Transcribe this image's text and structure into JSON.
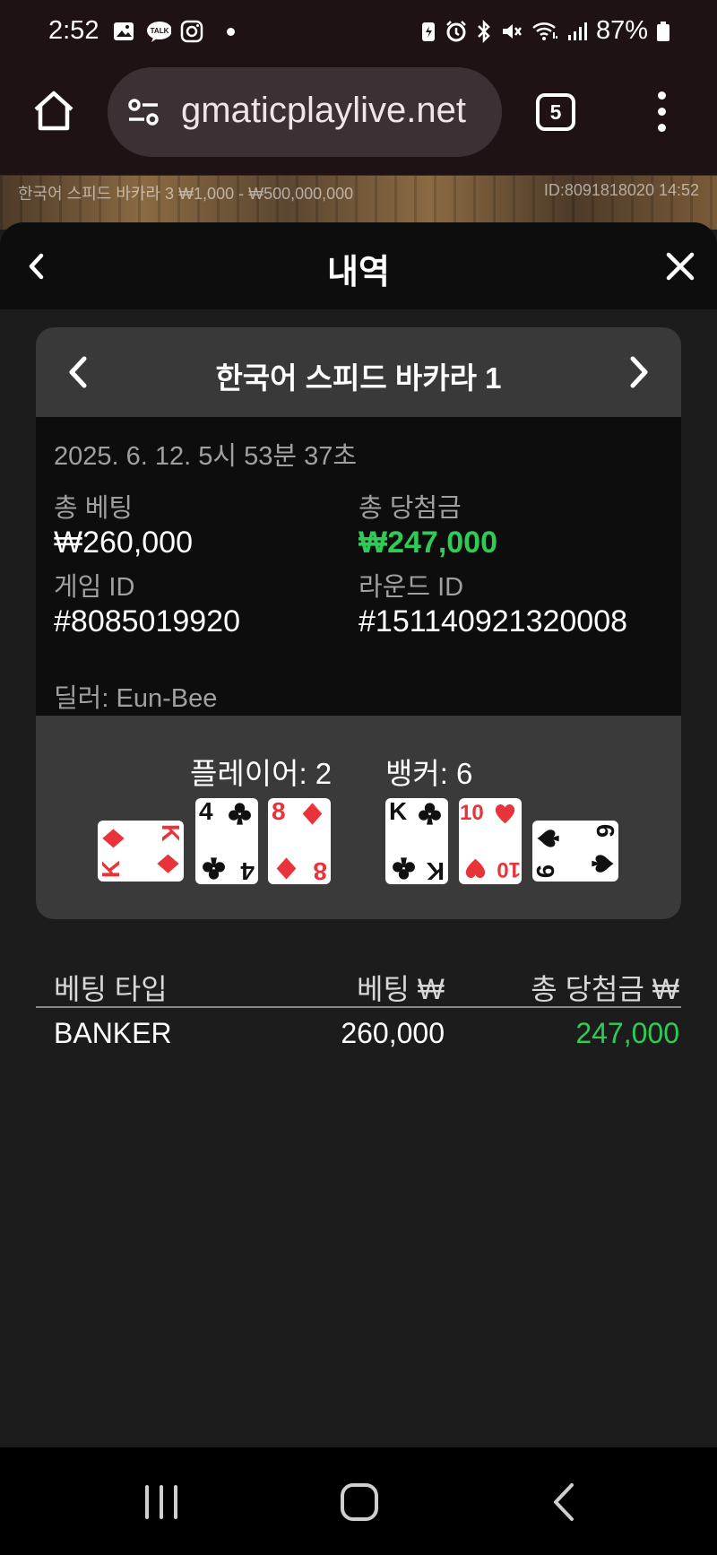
{
  "status_bar": {
    "time": "2:52",
    "battery": "87%",
    "left_icons": [
      "gallery-icon",
      "kakaotalk-icon",
      "instagram-icon",
      "dot-icon"
    ],
    "right_icons": [
      "battery-saver-icon",
      "alarm-icon",
      "bluetooth-icon",
      "mute-icon",
      "wifi-icon",
      "signal-icon",
      "battery-icon"
    ]
  },
  "browser": {
    "url": "gmaticplaylive.net",
    "tab_count": "5"
  },
  "game_strip": {
    "left_text": "한국어 스피드 바카라 3   ₩1,000 - ₩500,000,000",
    "right_text": "ID:8091818020   14:52"
  },
  "modal": {
    "title": "내역"
  },
  "game": {
    "name": "한국어 스피드 바카라 1",
    "datetime": "2025. 6. 12. 5시 53분 37초",
    "total_bet_label": "총 베팅",
    "total_bet_value": "₩260,000",
    "total_win_label": "총 당첨금",
    "total_win_value": "₩247,000",
    "game_id_label": "게임 ID",
    "game_id_value": "#8085019920",
    "round_id_label": "라운드 ID",
    "round_id_value": "#151140921320008",
    "dealer": "딜러: Eun-Bee"
  },
  "result": {
    "player_label": "플레이어: 2",
    "banker_label": "뱅커: 6",
    "player_cards": [
      {
        "rank": "K",
        "suit": "diamond",
        "color": "#e8333a",
        "rotated": true
      },
      {
        "rank": "4",
        "suit": "club",
        "color": "#111111",
        "rotated": false
      },
      {
        "rank": "8",
        "suit": "diamond",
        "color": "#e8333a",
        "rotated": false
      }
    ],
    "banker_cards": [
      {
        "rank": "K",
        "suit": "club",
        "color": "#111111",
        "rotated": false
      },
      {
        "rank": "10",
        "suit": "heart",
        "color": "#e8333a",
        "rotated": false
      },
      {
        "rank": "6",
        "suit": "spade",
        "color": "#111111",
        "rotated": true
      }
    ]
  },
  "bets": {
    "headers": [
      "베팅 타입",
      "베팅 ₩",
      "총 당첨금 ₩"
    ],
    "rows": [
      {
        "type": "BANKER",
        "bet": "260,000",
        "win": "247,000"
      }
    ]
  },
  "colors": {
    "win_green": "#2ecc56",
    "red_suit": "#e8333a"
  }
}
